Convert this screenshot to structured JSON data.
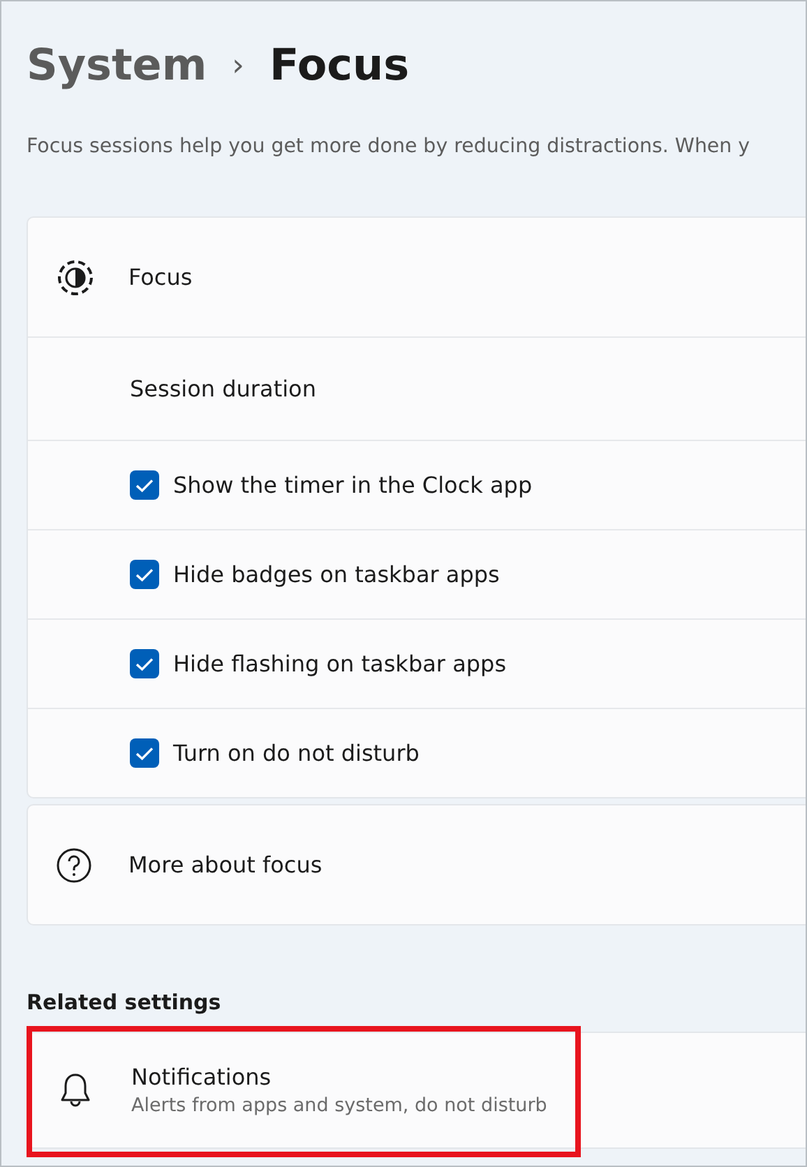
{
  "breadcrumb": {
    "parent": "System",
    "separator": "›",
    "current": "Focus"
  },
  "description": "Focus sessions help you get more done by reducing distractions. When y",
  "focus_card": {
    "title": "Focus",
    "session_label": "Session duration",
    "options": [
      {
        "label": "Show the timer in the Clock app",
        "checked": true
      },
      {
        "label": "Hide badges on taskbar apps",
        "checked": true
      },
      {
        "label": "Hide flashing on taskbar apps",
        "checked": true
      },
      {
        "label": "Turn on do not disturb",
        "checked": true
      }
    ]
  },
  "help_link": {
    "label": "More about focus"
  },
  "related": {
    "heading": "Related settings",
    "items": [
      {
        "title": "Notifications",
        "subtitle": "Alerts from apps and system, do not disturb",
        "highlighted": true
      }
    ]
  }
}
